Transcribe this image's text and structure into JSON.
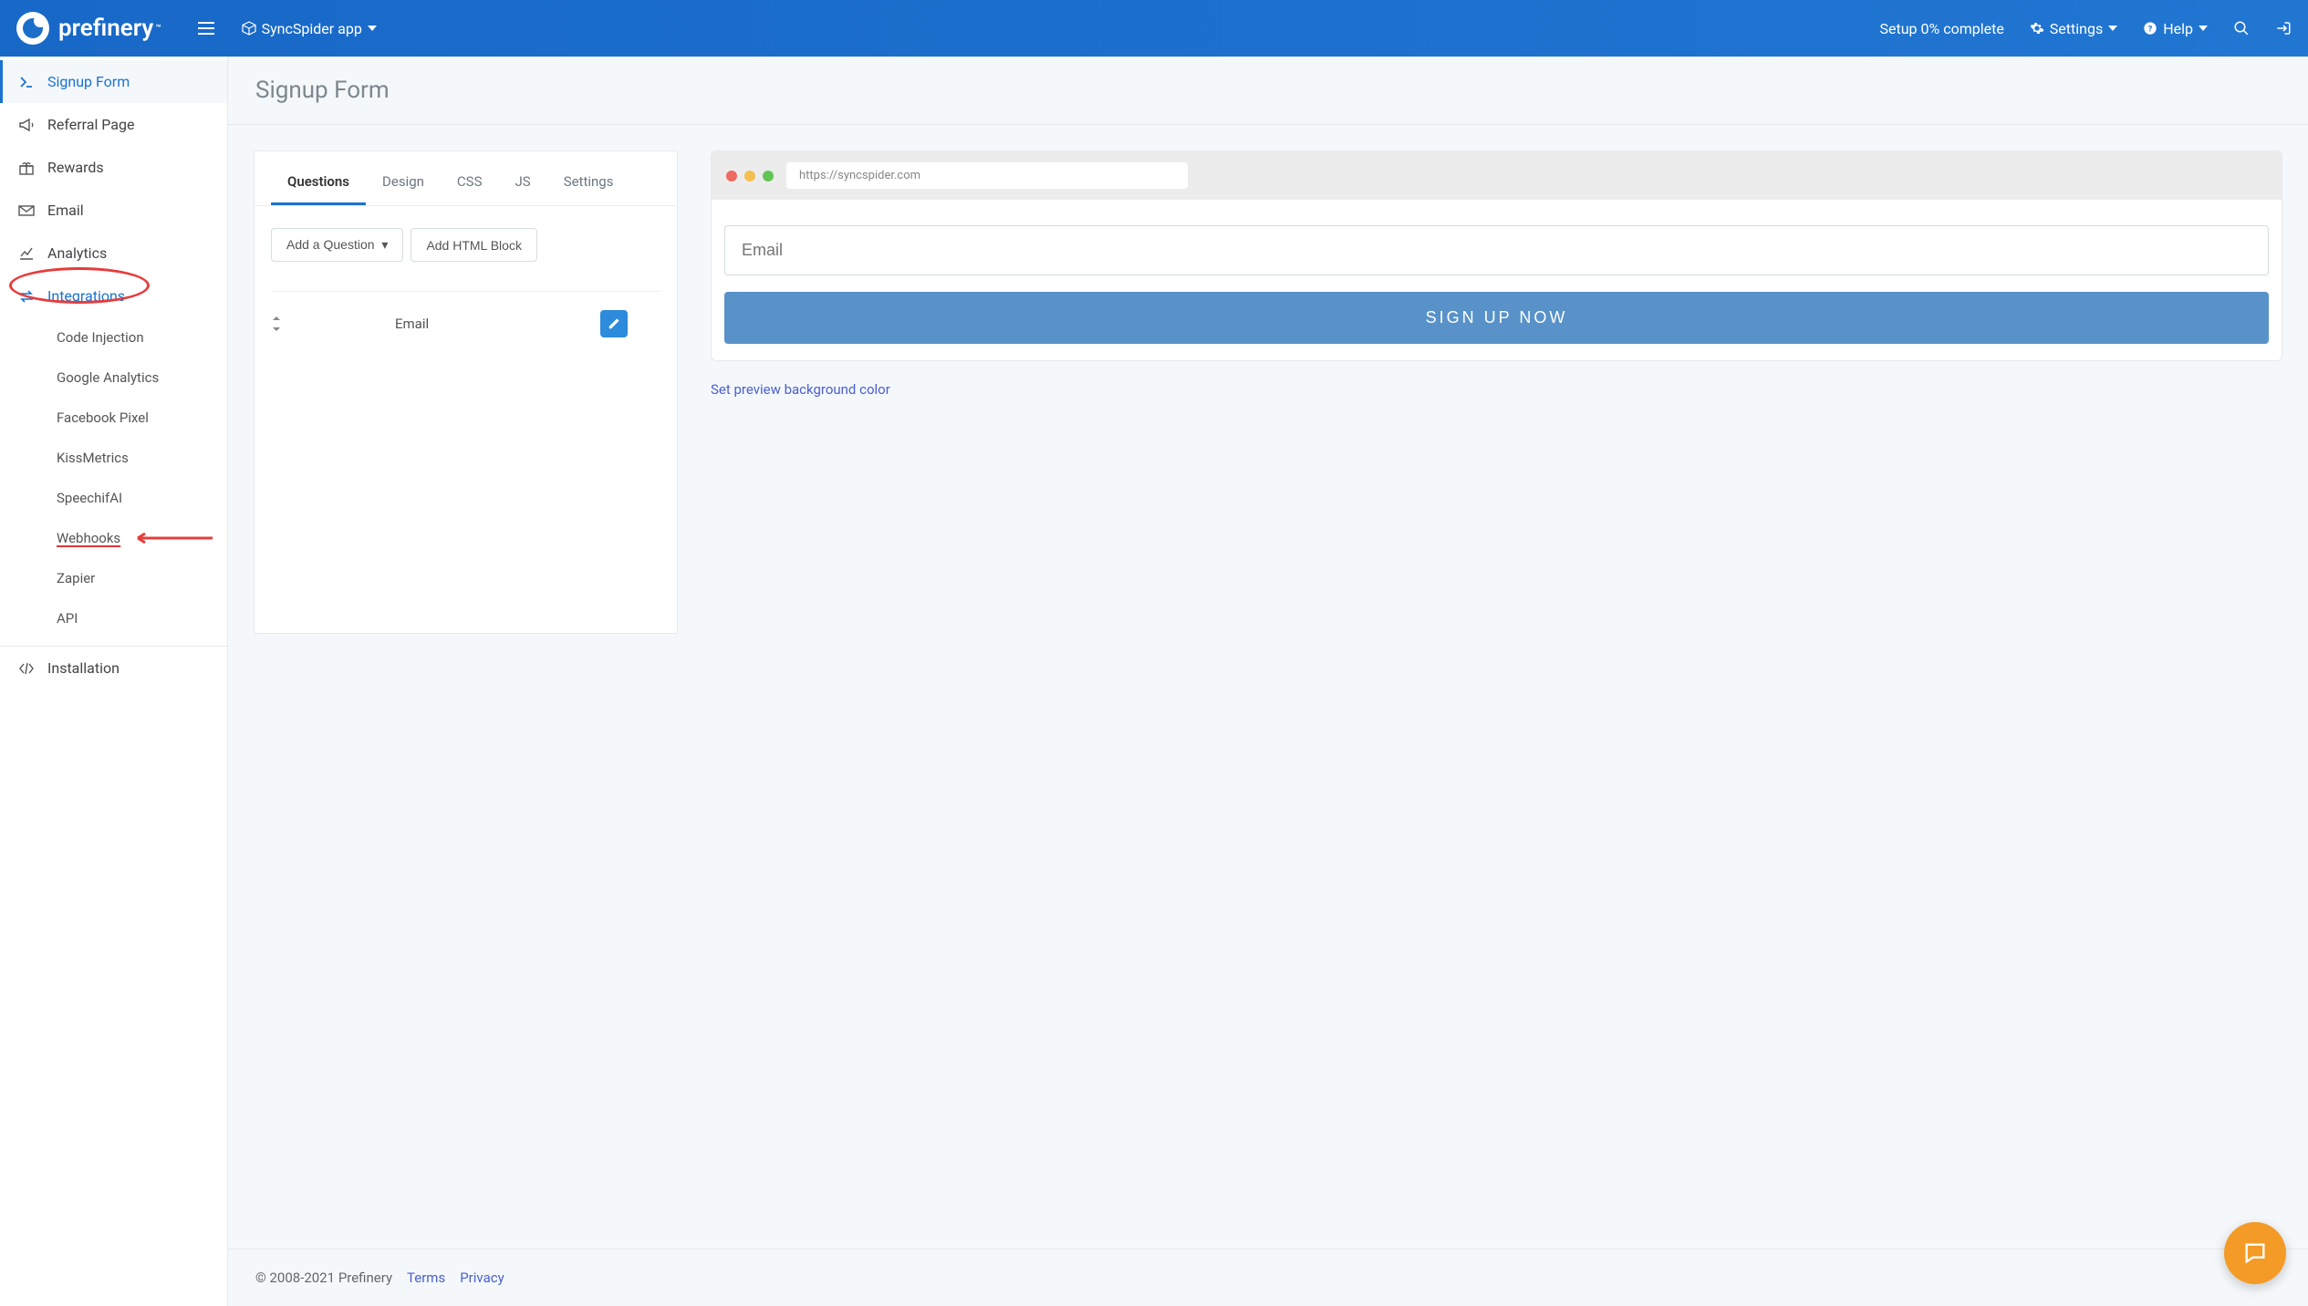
{
  "brand": {
    "name": "prefinery",
    "tm": "™"
  },
  "topbar": {
    "project_label": "SyncSpider app",
    "setup_status": "Setup 0% complete",
    "settings_label": "Settings",
    "help_label": "Help"
  },
  "sidebar": {
    "items": [
      {
        "label": "Signup Form"
      },
      {
        "label": "Referral Page"
      },
      {
        "label": "Rewards"
      },
      {
        "label": "Email"
      },
      {
        "label": "Analytics"
      },
      {
        "label": "Integrations"
      },
      {
        "label": "Installation"
      }
    ],
    "integrations_sub": [
      {
        "label": "Code Injection"
      },
      {
        "label": "Google Analytics"
      },
      {
        "label": "Facebook Pixel"
      },
      {
        "label": "KissMetrics"
      },
      {
        "label": "SpeechifAI"
      },
      {
        "label": "Webhooks"
      },
      {
        "label": "Zapier"
      },
      {
        "label": "API"
      }
    ]
  },
  "page": {
    "title": "Signup Form"
  },
  "tabs": [
    {
      "label": "Questions"
    },
    {
      "label": "Design"
    },
    {
      "label": "CSS"
    },
    {
      "label": "JS"
    },
    {
      "label": "Settings"
    }
  ],
  "buttons": {
    "add_question": "Add a Question",
    "add_html_block": "Add HTML Block"
  },
  "question_row": {
    "label": "Email"
  },
  "preview": {
    "url": "https://syncspider.com",
    "email_placeholder": "Email",
    "signup_button": "SIGN UP NOW",
    "bg_link": "Set preview background color"
  },
  "footer": {
    "copyright": "© 2008-2021 Prefinery",
    "terms": "Terms",
    "privacy": "Privacy"
  }
}
